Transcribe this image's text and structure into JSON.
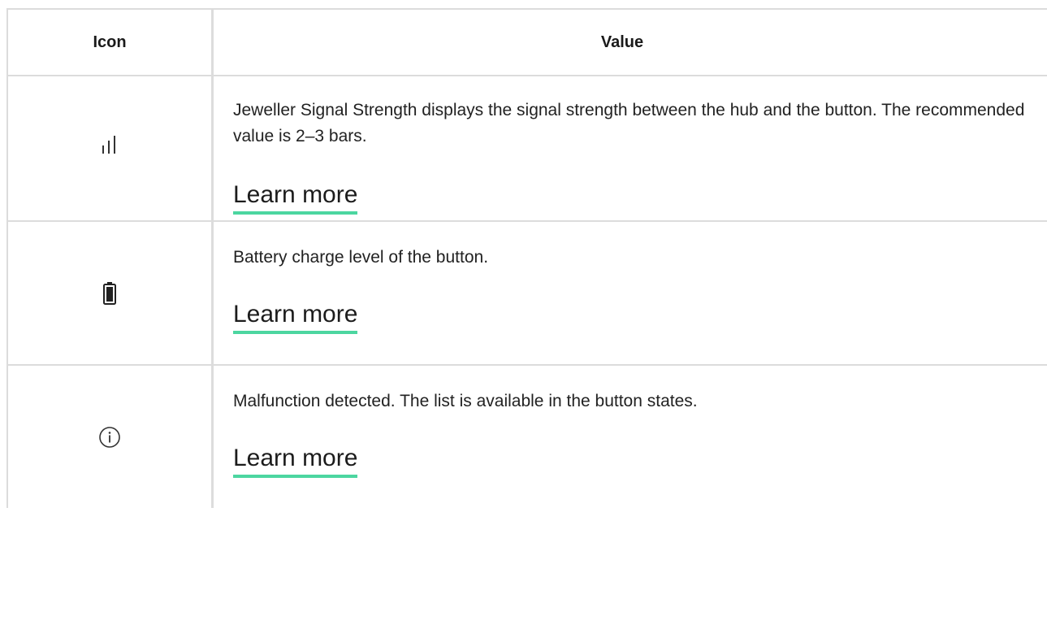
{
  "table": {
    "headers": {
      "icon": "Icon",
      "value": "Value"
    },
    "rows": [
      {
        "icon": "signal-strength-icon",
        "description": "Jeweller Signal Strength displays the signal strength between the hub and the button. The recommended value is 2–3 bars.",
        "link": "Learn more"
      },
      {
        "icon": "battery-icon",
        "description": "Battery charge level of the button.",
        "link": "Learn more"
      },
      {
        "icon": "info-icon",
        "description": "Malfunction detected. The list is available in the button states.",
        "link": "Learn more"
      }
    ]
  },
  "colors": {
    "link_underline": "#4cd6a0",
    "border": "#dcdcdc",
    "text": "#222222"
  }
}
